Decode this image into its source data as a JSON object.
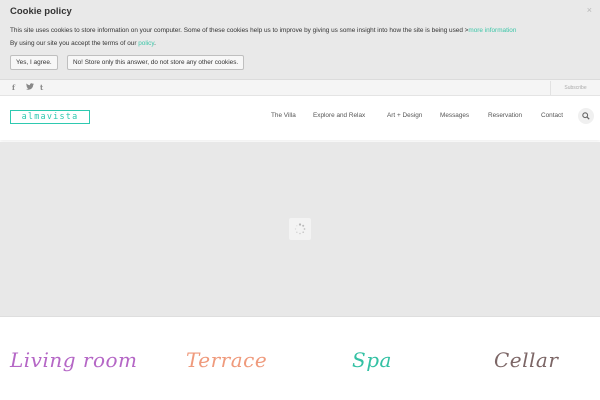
{
  "cookie": {
    "title": "Cookie policy",
    "close_glyph": "×",
    "text": "This site uses cookies to store information on your computer. Some of these cookies help us to improve by giving us some insight into how the site is being used >",
    "more_info_link": "more information",
    "terms_text": "By using our site you accept the terms of our ",
    "policy_link": "policy",
    "terms_end": ".",
    "agree_label": "Yes, I agree.",
    "decline_label": "No! Store only this answer, do not store any other cookies."
  },
  "topbar": {
    "social": [
      {
        "icon": "facebook-icon",
        "glyph": "f"
      },
      {
        "icon": "twitter-icon",
        "glyph": "𝕥"
      },
      {
        "icon": "tumblr-icon",
        "glyph": "t"
      }
    ],
    "subscribe_label": "Subscribe"
  },
  "header": {
    "logo_text": "almavista",
    "nav": [
      "The Villa",
      "Explore and Relax",
      "Art + Design",
      "Messages",
      "Reservation",
      "Contact"
    ],
    "search_icon": "search-icon"
  },
  "features": [
    "Living room",
    "Terrace",
    "Spa",
    "Cellar"
  ],
  "colors": {
    "accent": "#2ec9b0",
    "living_room": "#b567c6",
    "terrace": "#ef9a7c",
    "spa": "#34c1a4",
    "cellar": "#7c6666"
  }
}
